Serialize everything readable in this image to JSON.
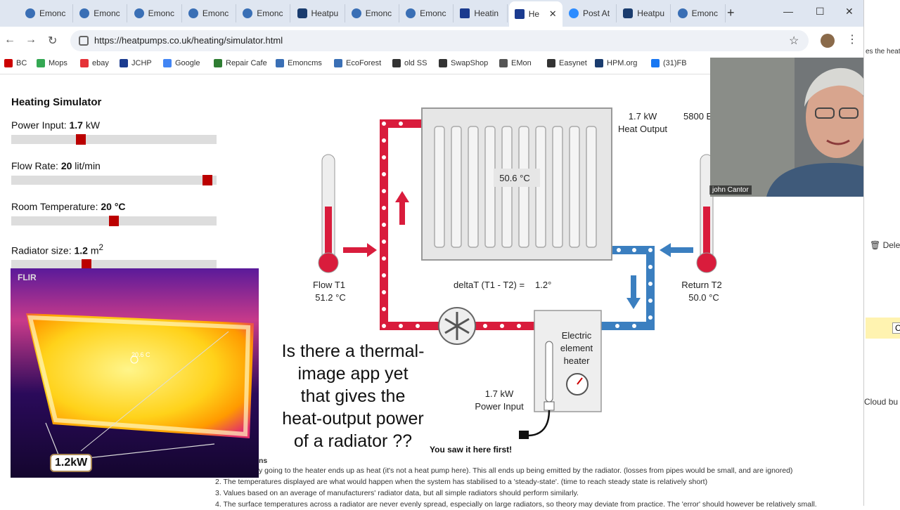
{
  "browser": {
    "tabs": [
      {
        "label": "Emonc",
        "icon": "emoncms-icon"
      },
      {
        "label": "Emonc",
        "icon": "emoncms-icon"
      },
      {
        "label": "Emonc",
        "icon": "emoncms-icon"
      },
      {
        "label": "Emonc",
        "icon": "emoncms-icon"
      },
      {
        "label": "Emonc",
        "icon": "emoncms-icon"
      },
      {
        "label": "Heatpu",
        "icon": "openenergymonitor-icon"
      },
      {
        "label": "Emonc",
        "icon": "emoncms-icon"
      },
      {
        "label": "Emonc",
        "icon": "emoncms-icon"
      },
      {
        "label": "Heatin",
        "icon": "jchp-icon"
      },
      {
        "label": "He",
        "icon": "jchp-icon",
        "active": true
      },
      {
        "label": "Post At",
        "icon": "zoom-icon"
      },
      {
        "label": "Heatpu",
        "icon": "openenergymonitor-icon"
      },
      {
        "label": "Emonc",
        "icon": "emoncms-icon"
      }
    ],
    "url": "https://heatpumps.co.uk/heating/simulator.html",
    "bookmarks": [
      {
        "label": "BC",
        "color": "#c00"
      },
      {
        "label": "Mops",
        "color": "#34a853"
      },
      {
        "label": "ebay",
        "color": "#e53238"
      },
      {
        "label": "JCHP",
        "color": "#1b3b8f"
      },
      {
        "label": "Google",
        "color": "#4285f4"
      },
      {
        "label": "Repair Cafe",
        "color": "#2e7d32"
      },
      {
        "label": "Emoncms",
        "color": "#3a6fb5"
      },
      {
        "label": "EcoForest",
        "color": "#3a6fb5"
      },
      {
        "label": "old SS",
        "color": "#333"
      },
      {
        "label": "SwapShop",
        "color": "#333"
      },
      {
        "label": "EMon",
        "color": "#555"
      },
      {
        "label": "Easynet",
        "color": "#333"
      },
      {
        "label": "HPM.org",
        "color": "#1a3c6e"
      },
      {
        "label": "(31)FB",
        "color": "#1877f2"
      }
    ]
  },
  "simulator": {
    "title": "Heating Simulator",
    "power": {
      "label": "Power Input:",
      "value": "1.7",
      "unit": "kW",
      "fraction": 0.33
    },
    "flow": {
      "label": "Flow Rate:",
      "value": "20",
      "unit": "lit/min",
      "fraction": 0.98
    },
    "room": {
      "label": "Room Temperature:",
      "value": "20 °C",
      "fraction": 0.5
    },
    "radiator": {
      "label": "Radiator size:",
      "value": "1.2",
      "unit": "m",
      "unit_sup": "2",
      "fraction": 0.36
    }
  },
  "diagram": {
    "radiator_temp": "50.6 °C",
    "heat_output_value": "1.7 kW",
    "heat_output_label": "Heat Output",
    "btu": "5800 B",
    "flow_label": "Flow T1",
    "flow_temp": "51.2 °C",
    "return_label": "Return T2",
    "return_temp": "50.0 °C",
    "delta_label": "deltaT (T1 - T2) =",
    "delta_value": "1.2°",
    "heater_line1": "Electric",
    "heater_line2": "element",
    "heater_line3": "heater",
    "power_input_value": "1.7 kW",
    "power_input_label": "Power Input",
    "colors": {
      "hot": "#d91c3c",
      "cold": "#3b7fc0"
    }
  },
  "overlay": {
    "flir_logo": "FLIR",
    "flir_spot": "20.6 C",
    "flir_badge": "1.2kW",
    "question": "Is there a thermal-image app yet that gives the heat-output power of a radiator ??",
    "question_lines": [
      "Is there a thermal-",
      "image app yet",
      "that gives the",
      "heat-output power",
      "of a radiator ??"
    ],
    "saw_it": "You saw it here first!"
  },
  "notes": {
    "heading_tail": "ns",
    "lines": [
      "y going to the heater ends up as heat (it's not a heat pump here). This all ends up being emitted by the radiator. (losses from pipes would be small, and are ignored)",
      "2. The temperatures displayed are what would happen when the system has stabilised to a 'steady-state'. (time to reach steady state is relatively short)",
      "3. Values based on an average of manufacturers' radiator data, but all simple radiators should perform similarly.",
      "4. The surface temperatures across a radiator are never evenly spread, especially on large radiators, so theory may deviate from practice. The 'error' should however be relatively small."
    ]
  },
  "webcam": {
    "name": "john Cantor"
  },
  "right_panel": {
    "text1": "es the heat",
    "delete": "Delet",
    "cloud": "Cloud bu",
    "yellow_btn": "C"
  }
}
